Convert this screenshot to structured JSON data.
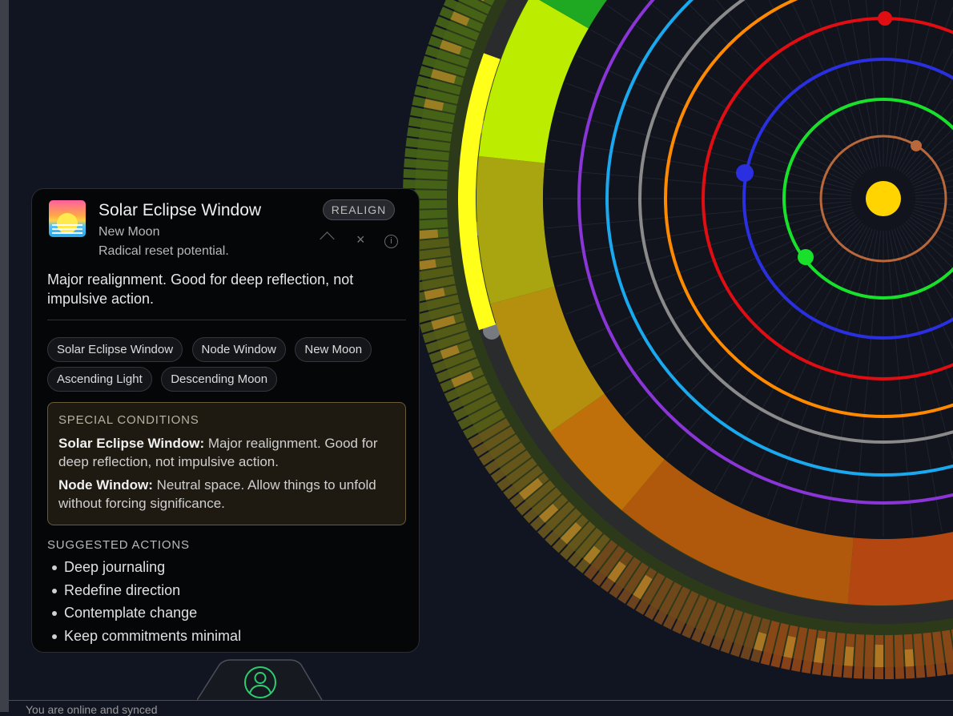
{
  "panel": {
    "title": "Solar Eclipse Window",
    "subtitle": "New Moon",
    "tagline": "Radical reset potential.",
    "badge": "REALIGN",
    "icon": "sunrise-icon",
    "controls": {
      "collapse_icon": "chevron-up-icon",
      "close_icon": "close-icon",
      "close_glyph": "×",
      "info_icon": "info-icon",
      "info_glyph": "i"
    },
    "description": "Major realignment. Good for deep reflection, not impulsive action.",
    "tags": [
      "Solar Eclipse Window",
      "Node Window",
      "New Moon",
      "Ascending Light",
      "Descending Moon"
    ],
    "special": {
      "heading": "SPECIAL CONDITIONS",
      "items": [
        {
          "name": "Solar Eclipse Window:",
          "text": "Major realignment. Good for deep reflection, not impulsive action."
        },
        {
          "name": "Node Window:",
          "text": "Neutral space. Allow things to unfold without forcing significance."
        }
      ]
    },
    "actions": {
      "heading": "SUGGESTED ACTIONS",
      "items": [
        "Deep journaling",
        "Redefine direction",
        "Contemplate change",
        "Keep commitments minimal"
      ]
    }
  },
  "bottom_tab": {
    "icon": "user-icon",
    "accent": "#2ecc71"
  },
  "status": {
    "text": "You are online and synced"
  },
  "colors": {
    "background": "#101521",
    "sun": "#ffd400",
    "orbits": [
      "#b8683a",
      "#19e02a",
      "#2a2fe0",
      "#e00d12",
      "#ff8a00",
      "#8a8a8a",
      "#1aa8ee",
      "#8a35d6"
    ]
  }
}
